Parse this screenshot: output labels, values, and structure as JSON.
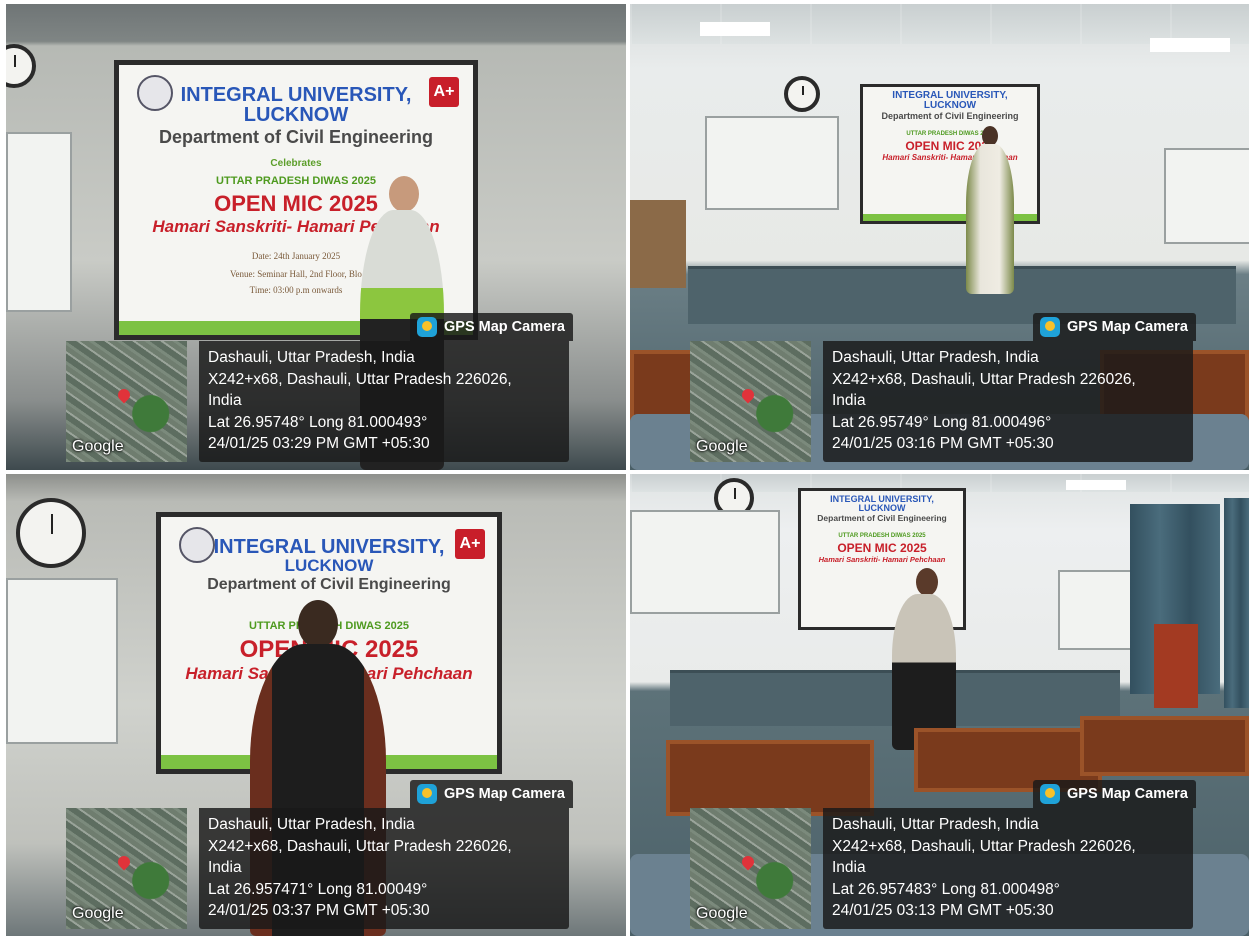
{
  "screen_slide": {
    "university": "INTEGRAL UNIVERSITY,",
    "city": "LUCKNOW",
    "department": "Department of Civil Engineering",
    "celebrates": "Celebrates",
    "event_line": "UTTAR PRADESH DIWAS 2025",
    "title": "OPEN MIC 2025",
    "tagline": "Hamari Sanskriti- Hamari Pehchaan",
    "date": "Date: 24th January 2025",
    "venue": "Venue: Seminar Hall, 2nd Floor, Blo",
    "time": "Time: 03:00 p.m onwards",
    "grade": "A+"
  },
  "photos": [
    {
      "badge": "GPS Map Camera",
      "map_brand": "Google",
      "place": "Dashauli, Uttar Pradesh, India",
      "address": "X242+x68, Dashauli, Uttar Pradesh 226026,",
      "country": "India",
      "coords": "Lat 26.95748° Long 81.000493°",
      "timestamp": "24/01/25 03:29 PM GMT +05:30"
    },
    {
      "badge": "GPS Map Camera",
      "map_brand": "Google",
      "place": "Dashauli, Uttar Pradesh, India",
      "address": "X242+x68, Dashauli, Uttar Pradesh 226026,",
      "country": "India",
      "coords": "Lat 26.95749° Long 81.000496°",
      "timestamp": "24/01/25 03:16 PM GMT +05:30"
    },
    {
      "badge": "GPS Map Camera",
      "map_brand": "Google",
      "place": "Dashauli, Uttar Pradesh, India",
      "address": "X242+x68, Dashauli, Uttar Pradesh 226026,",
      "country": "India",
      "coords": "Lat 26.957471° Long 81.00049°",
      "timestamp": "24/01/25 03:37 PM GMT +05:30"
    },
    {
      "badge": "GPS Map Camera",
      "map_brand": "Google",
      "place": "Dashauli, Uttar Pradesh, India",
      "address": "X242+x68, Dashauli, Uttar Pradesh 226026,",
      "country": "India",
      "coords": "Lat 26.957483° Long 81.000498°",
      "timestamp": "24/01/25 03:13 PM GMT +05:30"
    }
  ],
  "colors": {
    "brand_blue": "#2957b8",
    "title_red": "#c8202a",
    "accent_green": "#7cc243",
    "overlay": "#191919"
  }
}
